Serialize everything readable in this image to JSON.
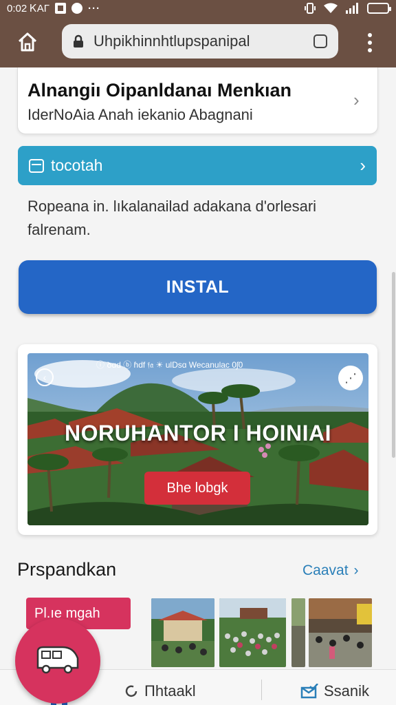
{
  "status_bar": {
    "time": "0:02 ᏦAΓ",
    "more": "···"
  },
  "browser": {
    "url": "Uhpіkhinnhtlupspanipal"
  },
  "info_card": {
    "title": "Alnangiı Oipanldanaı Menkıan",
    "subtitle": "IderNoAia Anah iekanio Abagnani"
  },
  "banner": {
    "label": "tocotah"
  },
  "description": "Ropeana in. lıkalanailad adakana d'orlesari falrenam.",
  "install_label": "INSTAL",
  "hero": {
    "top_text": "ⓘ ꝺɑd ⓑ ɦdf 𝔣𝔞 ☀ ulDsɑ Wecanulac 0ʃ0",
    "title": "NORUHANTOR I HOINIAI",
    "cta": "Bhe lobgk"
  },
  "section": {
    "title": "Prspandkan",
    "link": "Caavat"
  },
  "tag_label": "Pl.ıe mgah",
  "bottom_nav": {
    "item2": "Πhtaakl",
    "item3": "Ssanik"
  },
  "colors": {
    "brand": "#6b5043",
    "teal": "#2da0c8",
    "install": "#2466c6",
    "accent": "#d6335e",
    "cta": "#d32f3a"
  }
}
